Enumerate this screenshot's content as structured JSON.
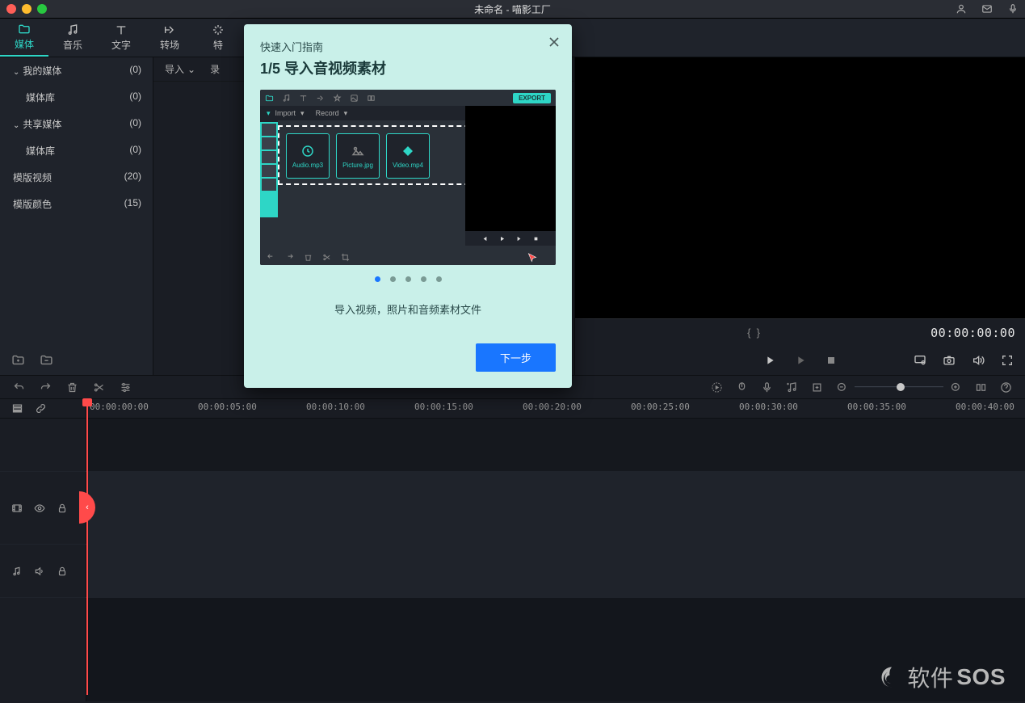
{
  "titlebar": {
    "title": "未命名 - 喵影工厂"
  },
  "tabs": {
    "media": "媒体",
    "music": "音乐",
    "text": "文字",
    "transition": "转场",
    "effect": "特"
  },
  "sidebar": {
    "my_media": "我的媒体",
    "my_media_count": "(0)",
    "library1": "媒体库",
    "library1_count": "(0)",
    "shared": "共享媒体",
    "shared_count": "(0)",
    "library2": "媒体库",
    "library2_count": "(0)",
    "tpl_video": "模版视频",
    "tpl_video_count": "(20)",
    "tpl_color": "模版颜色",
    "tpl_color_count": "(15)"
  },
  "mediapane": {
    "import": "导入",
    "record": "录"
  },
  "preview": {
    "timecode": "00:00:00:00"
  },
  "ruler": {
    "t0": "00:00:00:00",
    "t1": "00:00:05:00",
    "t2": "00:00:10:00",
    "t3": "00:00:15:00",
    "t4": "00:00:20:00",
    "t5": "00:00:25:00",
    "t6": "00:00:30:00",
    "t7": "00:00:35:00",
    "t8": "00:00:40:00"
  },
  "modal": {
    "subtitle": "快速入门指南",
    "title": "1/5 导入音视频素材",
    "desc": "导入视频，照片和音频素材文件",
    "next": "下一步",
    "export": "EXPORT",
    "import_lbl": "Import",
    "record_lbl": "Record",
    "f_audio": "Audio.mp3",
    "f_pic": "Picture.jpg",
    "f_vid": "Video.mp4"
  },
  "watermark": {
    "a": "软件",
    "b": "SOS"
  }
}
